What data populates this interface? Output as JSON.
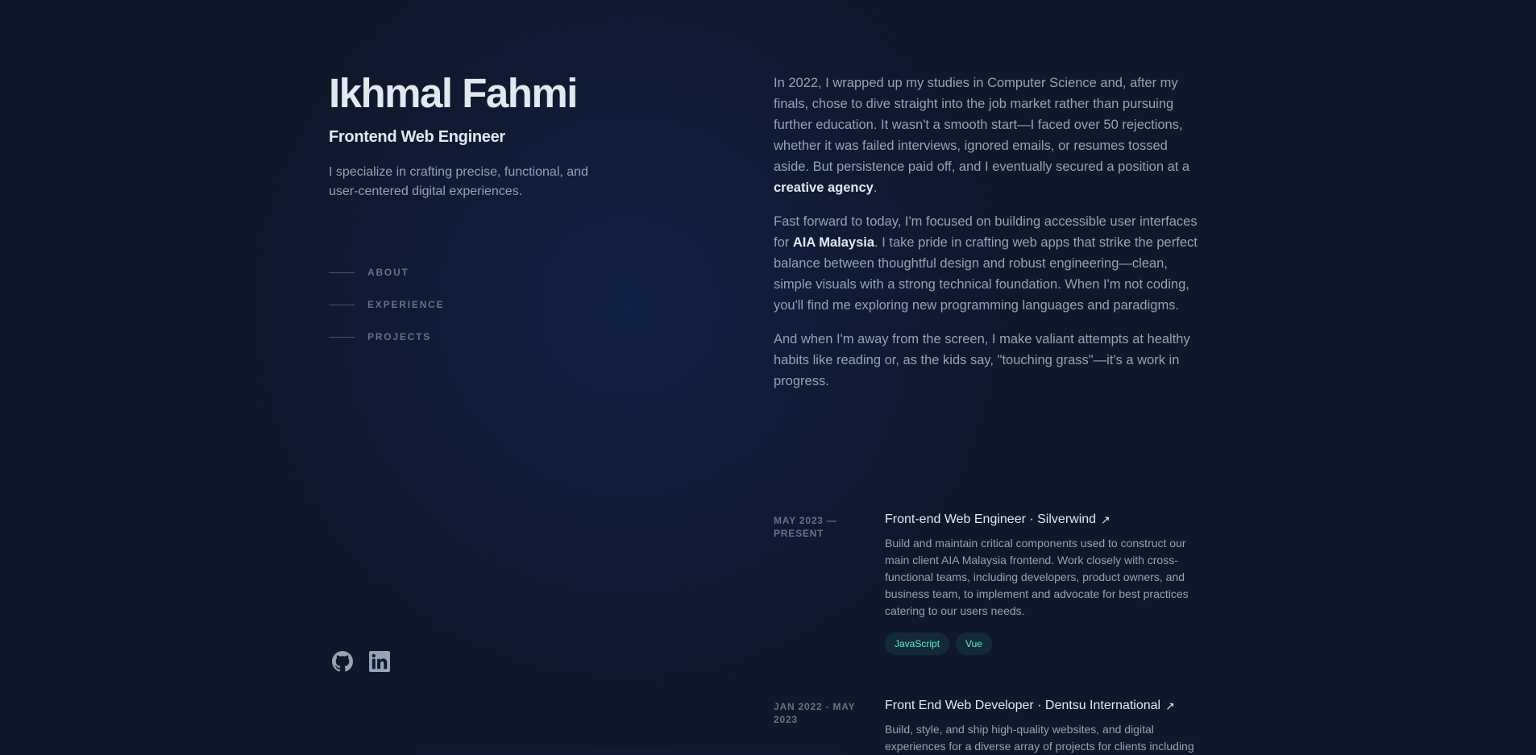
{
  "profile": {
    "name": "Ikhmal Fahmi",
    "role": "Frontend Web Engineer",
    "tagline": "I specialize in crafting precise, functional, and user-centered digital experiences."
  },
  "nav": {
    "items": [
      {
        "label": "ABOUT"
      },
      {
        "label": "EXPERIENCE"
      },
      {
        "label": "PROJECTS"
      }
    ]
  },
  "socials": {
    "github_icon": "github-icon",
    "linkedin_icon": "linkedin-icon"
  },
  "about": {
    "p1_text": "In 2022, I wrapped up my studies in Computer Science and, after my finals, chose to dive straight into the job market rather than pursuing further education. It wasn't a smooth start—I faced over 50 rejections, whether it was failed interviews, ignored emails, or resumes tossed aside. But persistence paid off, and I eventually secured a position at a ",
    "p1_strong": "creative agency",
    "p1_end": ".",
    "p2_start": "Fast forward to today, I'm focused on building accessible user interfaces for ",
    "p2_strong": "AIA Malaysia",
    "p2_text": ". I take pride in crafting web apps that strike the perfect balance between thoughtful design and robust engineering—clean, simple visuals with a strong technical foundation. When I'm not coding, you'll find me exploring new programming languages and paradigms.",
    "p3_text": "And when I'm away from the screen, I make valiant attempts at healthy habits like reading or, as the kids say, \"touching grass\"—it's a work in progress."
  },
  "experience": {
    "jobs": [
      {
        "date_line1": "MAY 2023 —",
        "date_line2": "PRESENT",
        "title": "Front-end Web Engineer · Silverwind",
        "description": "Build and maintain critical components used to construct our main client AIA Malaysia frontend. Work closely with cross-functional teams, including developers, product owners, and business team, to implement and advocate for best practices catering to our users needs.",
        "tags": [
          "JavaScript",
          "Vue"
        ]
      },
      {
        "date_line1": "JAN 2022 - MAY",
        "date_line2": "2023",
        "title": "Front End Web Developer · Dentsu International",
        "description": "Build, style, and ship high-quality websites, and digital experiences for a diverse array of projects for clients including"
      }
    ],
    "arrow_icon": "↗"
  },
  "colors": {
    "background": "#0f172a",
    "heading": "#e2e8f0",
    "body": "#94a3b8",
    "muted": "#64748b",
    "tag_text": "#5eead4"
  }
}
